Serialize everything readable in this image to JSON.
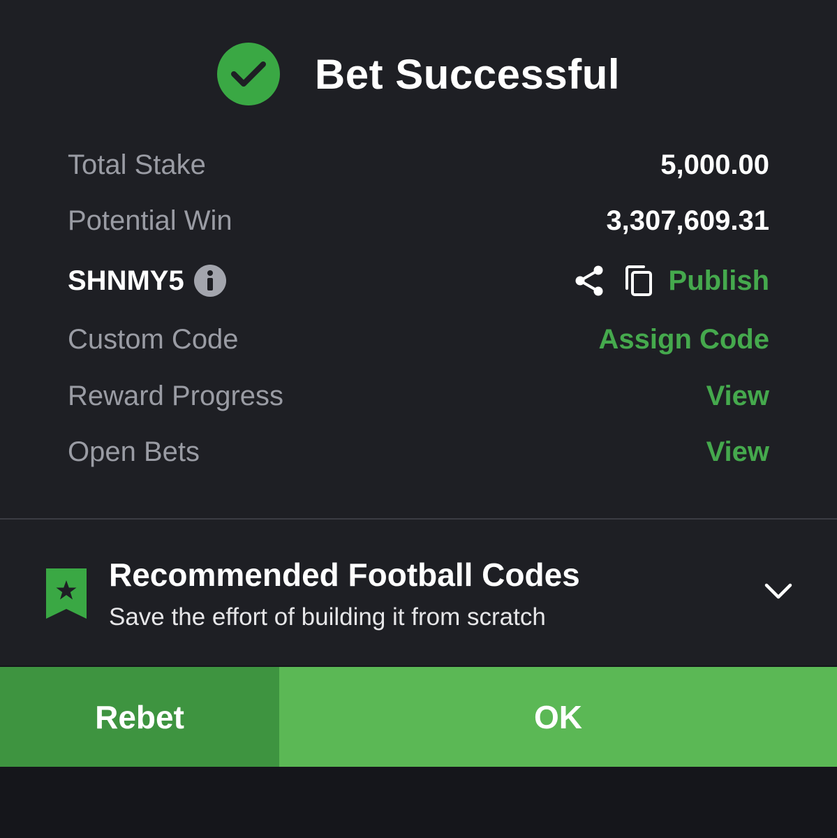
{
  "header": {
    "icon": "check-circle-icon",
    "title": "Bet Successful"
  },
  "summary": {
    "total_stake_label": "Total Stake",
    "total_stake_value": "5,000.00",
    "potential_win_label": "Potential Win",
    "potential_win_value": "3,307,609.31"
  },
  "booking": {
    "code": "SHNMY5",
    "info_icon": "info-icon",
    "share_icon": "share-icon",
    "copy_icon": "copy-icon",
    "publish_label": "Publish"
  },
  "links": {
    "custom_code_label": "Custom Code",
    "custom_code_action": "Assign Code",
    "reward_progress_label": "Reward Progress",
    "reward_progress_action": "View",
    "open_bets_label": "Open Bets",
    "open_bets_action": "View"
  },
  "recommended": {
    "icon": "bookmark-star-icon",
    "title": "Recommended Football Codes",
    "subtitle": "Save the effort of building it from scratch",
    "expand_icon": "chevron-down-icon"
  },
  "buttons": {
    "rebet_label": "Rebet",
    "ok_label": "OK"
  },
  "colors": {
    "accent_green": "#45a94d",
    "panel_bg": "#1e1f24",
    "rebet_bg": "#3e9440",
    "ok_bg": "#5bb855"
  }
}
